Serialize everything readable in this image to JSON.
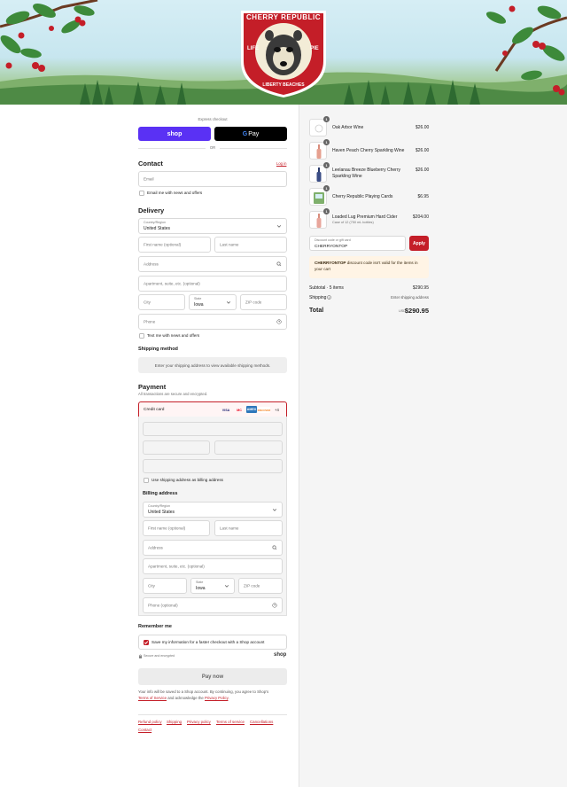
{
  "brand": {
    "name_top": "CHERRY REPUBLIC",
    "motto_left": "LIFE",
    "motto_bottom": "LIBERTY BEACHES",
    "motto_right": "PIE"
  },
  "express": {
    "label": "Express checkout",
    "shop_label": "shop",
    "gpay_g": "G",
    "gpay_label": "Pay",
    "or_label": "OR"
  },
  "contact": {
    "title": "Contact",
    "login_label": "Log in",
    "email_placeholder": "Email",
    "newsletter_label": "Email me with news and offers"
  },
  "delivery": {
    "title": "Delivery",
    "country_label": "Country/Region",
    "country_value": "United States",
    "first_name_placeholder": "First name (optional)",
    "last_name_placeholder": "Last name",
    "address_placeholder": "Address",
    "apartment_placeholder": "Apartment, suite, etc. (optional)",
    "city_placeholder": "City",
    "state_label": "State",
    "state_value": "Iowa",
    "zip_placeholder": "ZIP code",
    "phone_placeholder": "Phone",
    "sms_label": "Text me with news and offers"
  },
  "shipping_method": {
    "title": "Shipping method",
    "message": "Enter your shipping address to view available shipping methods."
  },
  "payment": {
    "title": "Payment",
    "subtitle": "All transactions are secure and encrypted.",
    "credit_card_label": "Credit card",
    "card_logos": [
      "VISA",
      "MC",
      "AMEX",
      "DISCOVER"
    ],
    "more_cards": "+4",
    "use_shipping_label": "Use shipping address as billing address"
  },
  "billing": {
    "title": "Billing address",
    "country_label": "Country/Region",
    "country_value": "United States",
    "first_name_placeholder": "First name (optional)",
    "last_name_placeholder": "Last name",
    "address_placeholder": "Address",
    "apartment_placeholder": "Apartment, suite, etc. (optional)",
    "city_placeholder": "City",
    "state_label": "State",
    "state_value": "Iowa",
    "zip_placeholder": "ZIP code",
    "phone_placeholder": "Phone (optional)"
  },
  "remember": {
    "title": "Remember me",
    "save_label": "Save my information for a faster checkout with a Shop account",
    "secure_label": "Secure and encrypted",
    "shop_logo": "shop"
  },
  "pay_now": "Pay now",
  "legal": {
    "line1": "Your info will be saved to a Shop account. By continuing, you agree to Shop's",
    "terms": "Terms of Service",
    "and_ack": "and acknowledge the",
    "privacy": "Privacy Policy",
    "period": "."
  },
  "footer_links": [
    "Refund policy",
    "Shipping",
    "Privacy policy",
    "Terms of service",
    "Cancellations",
    "Contact"
  ],
  "cart": {
    "items": [
      {
        "qty": "1",
        "name": "Oak Arbor Wine",
        "sub": "",
        "price": "$26.00"
      },
      {
        "qty": "1",
        "name": "Haven Peach Cherry Sparkling Wine",
        "sub": "",
        "price": "$26.00"
      },
      {
        "qty": "1",
        "name": "Leelanau Breeze Blueberry Cherry",
        "name2": "Sparkling Wine",
        "sub": "",
        "price": "$26.00"
      },
      {
        "qty": "1",
        "name": "Cherry Republic Playing Cards",
        "sub": "",
        "price": "$6.95"
      },
      {
        "qty": "1",
        "name": "Loaded Lug Premium Hard Cider",
        "sub": "Case of 12 (750 mL bottles)",
        "price": "$204.00"
      }
    ],
    "discount_label": "Discount code or gift card",
    "discount_value": "CHERRYONTOP",
    "apply_label": "Apply",
    "notice_code": "CHERRYONTOP",
    "notice_text": "discount code isn't valid for the items in your cart",
    "subtotal_label": "Subtotal · 5 items",
    "subtotal_value": "$290.95",
    "shipping_label": "Shipping",
    "shipping_value": "Enter shipping address",
    "total_label": "Total",
    "currency": "USD",
    "total_value": "$290.95"
  }
}
